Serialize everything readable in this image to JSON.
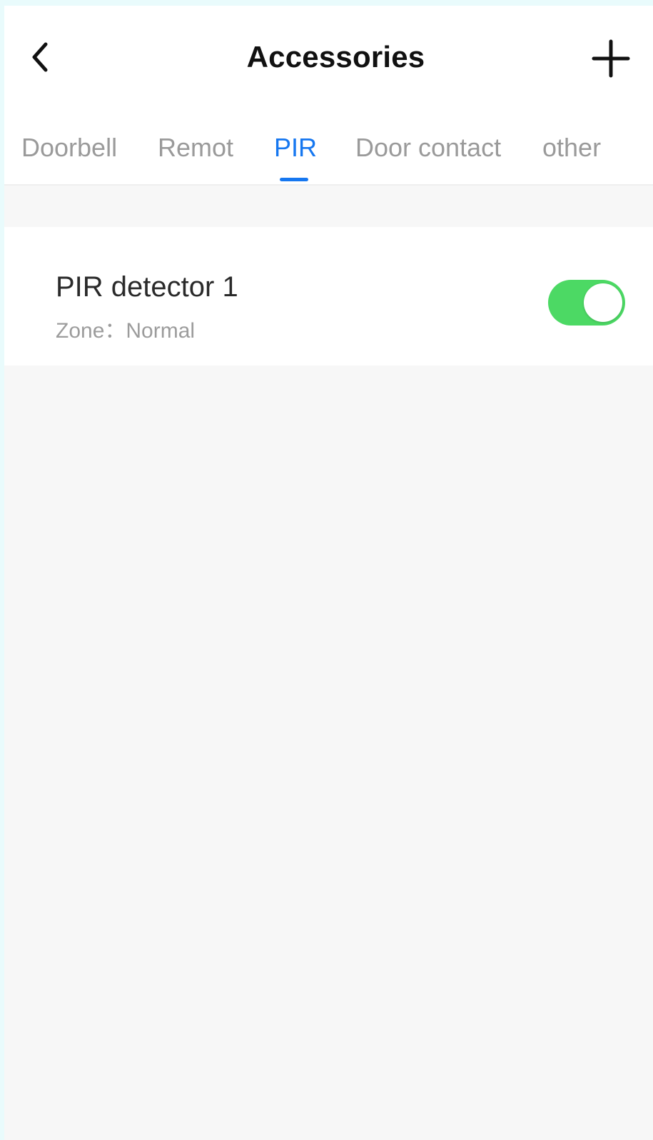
{
  "header": {
    "title": "Accessories",
    "back_icon": "chevron-left-icon",
    "add_icon": "plus-icon"
  },
  "tabs": [
    {
      "label": "Doorbell",
      "active": false
    },
    {
      "label": "Remot",
      "active": false
    },
    {
      "label": "PIR",
      "active": true
    },
    {
      "label": "Door contact",
      "active": false
    },
    {
      "label": "other",
      "active": false
    }
  ],
  "devices": [
    {
      "name": "PIR detector 1",
      "zone": "Zone：Normal",
      "enabled": true
    }
  ],
  "colors": {
    "accent": "#1677f0",
    "toggle_on": "#4cd964",
    "background": "#f7f7f7"
  }
}
